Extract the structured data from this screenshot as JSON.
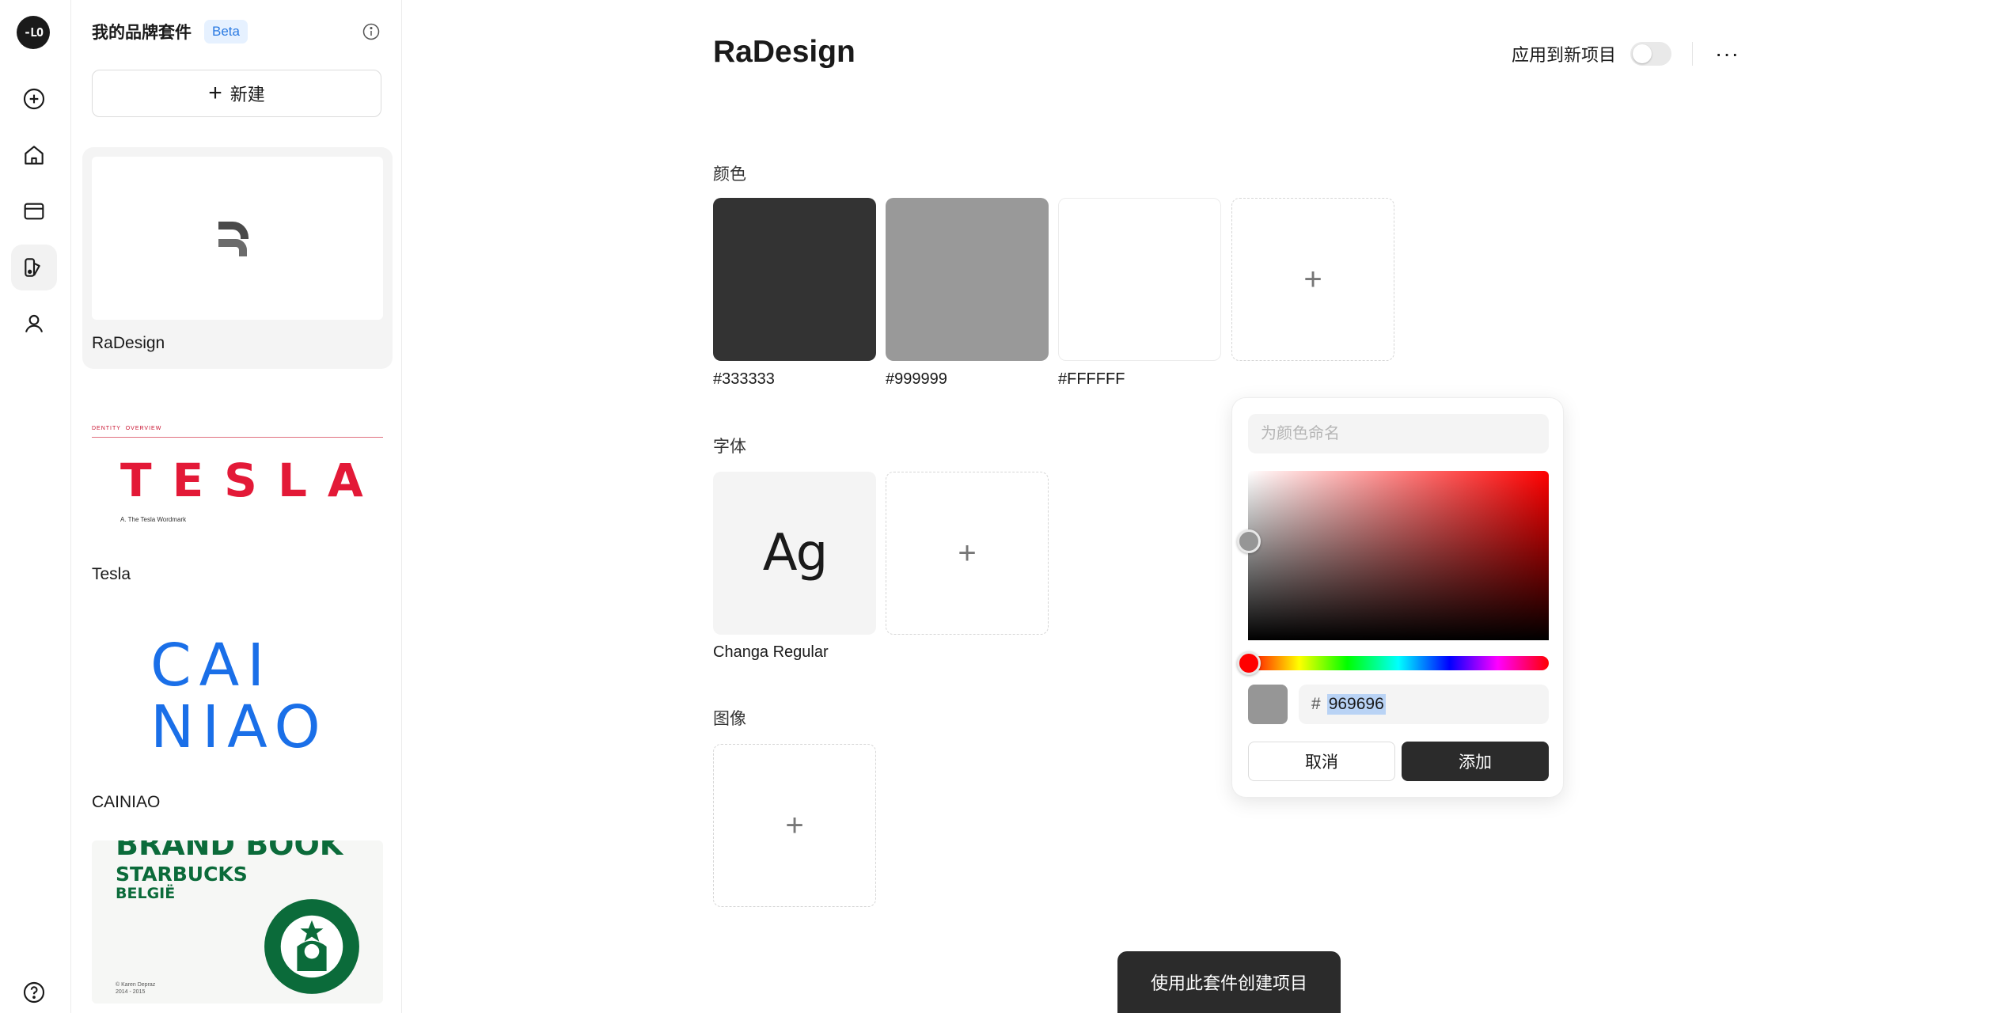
{
  "app": {
    "logo_text": "-LO"
  },
  "rail": {
    "items": [
      {
        "icon": "plus-circle-icon"
      },
      {
        "icon": "home-icon"
      },
      {
        "icon": "folder-icon"
      },
      {
        "icon": "brand-kit-icon",
        "active": true
      },
      {
        "icon": "user-icon"
      }
    ],
    "help_icon": "help-icon"
  },
  "kits_panel": {
    "title": "我的品牌套件",
    "badge": "Beta",
    "new_label": "新建",
    "kits": [
      {
        "name": "RaDesign",
        "active": true
      },
      {
        "name": "Tesla",
        "thumb_small": "DENTITY  OVERVIEW",
        "thumb_main": "TESLA",
        "thumb_caption": "A. The Tesla Wordmark"
      },
      {
        "name": "CAINIAO",
        "thumb_line1": "CAI",
        "thumb_line2": "NIAO"
      },
      {
        "name": "Starbucks België",
        "thumb_line1": "BRAND BOOK",
        "thumb_line2": "STARBUCKS",
        "thumb_line3": "BELGIË",
        "thumb_credit": "© Karen Depraz\n2014 - 2015"
      }
    ]
  },
  "main": {
    "title": "RaDesign",
    "apply_label": "应用到新项目",
    "more_label": "···",
    "sections": {
      "colors": "颜色",
      "fonts": "字体",
      "images": "图像"
    },
    "colors": [
      {
        "hex": "#333333"
      },
      {
        "hex": "#999999"
      },
      {
        "hex": "#FFFFFF"
      }
    ],
    "fonts": [
      {
        "sample": "Ag",
        "name": "Changa Regular"
      }
    ],
    "add_symbol": "+",
    "cta_label": "使用此套件创建项目"
  },
  "picker": {
    "name_placeholder": "为颜色命名",
    "hash": "#",
    "hex_value": "969696",
    "preview_color": "#969696",
    "cancel_label": "取消",
    "add_label": "添加"
  }
}
